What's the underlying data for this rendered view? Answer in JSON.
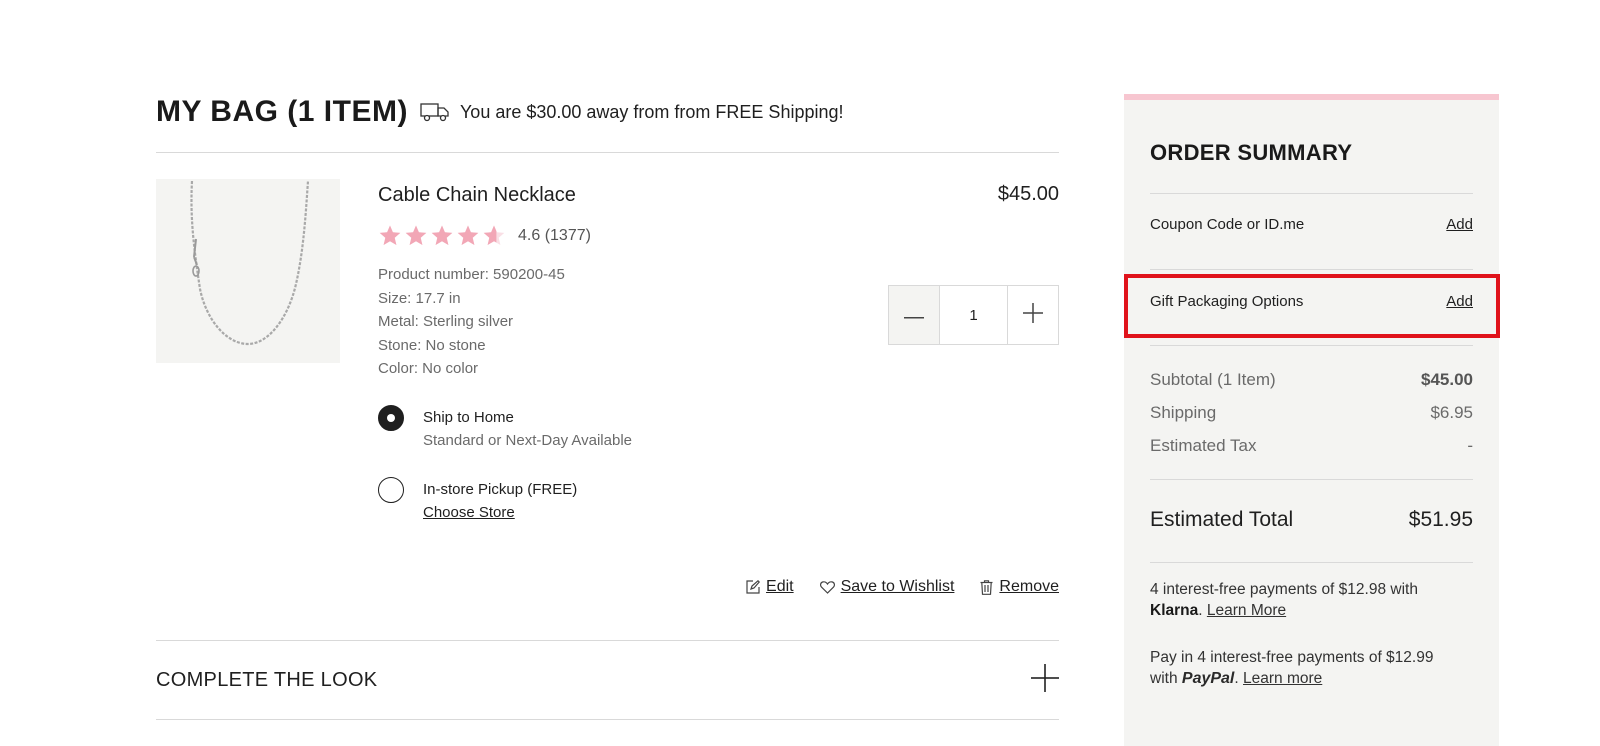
{
  "bag": {
    "title": "MY BAG (1 ITEM)",
    "shipping_message": "You are $30.00 away from from FREE Shipping!"
  },
  "item": {
    "name": "Cable Chain Necklace",
    "price": "$45.00",
    "rating_value": 4.6,
    "rating_text": "4.6 (1377)",
    "attributes": [
      "Product number: 590200-45",
      "Size: 17.7 in",
      "Metal: Sterling silver",
      "Stone: No stone",
      "Color: No color"
    ],
    "quantity": "1",
    "shipping_options": {
      "home_title": "Ship to Home",
      "home_sub": "Standard or Next-Day Available",
      "pickup_title": "In-store Pickup (FREE)",
      "pickup_link": "Choose Store"
    },
    "actions": {
      "edit": "Edit",
      "wishlist": "Save to Wishlist",
      "remove": "Remove"
    }
  },
  "complete_the_look": "COMPLETE THE LOOK",
  "summary": {
    "title": "ORDER SUMMARY",
    "coupon_label": "Coupon Code or ID.me",
    "coupon_action": "Add",
    "gift_label": "Gift Packaging Options",
    "gift_action": "Add",
    "subtotal_label": "Subtotal (1 Item)",
    "subtotal_value": "$45.00",
    "shipping_label": "Shipping",
    "shipping_value": "$6.95",
    "tax_label": "Estimated Tax",
    "tax_value": "-",
    "total_label": "Estimated Total",
    "total_value": "$51.95",
    "klarna_text": "4 interest-free payments of $12.98 with",
    "klarna_brand": "Klarna",
    "klarna_period": ".",
    "klarna_link": "Learn More",
    "paypal_text": "Pay in 4 interest-free payments of $12.99",
    "paypal_with": "with",
    "paypal_brand": "PayPal",
    "paypal_period": ".",
    "paypal_link": "Learn more"
  },
  "colors": {
    "star": "#f2a7b6",
    "summary_bg": "#f4f4f2",
    "summary_accent": "#f7c6d0",
    "highlight": "#e0131b"
  },
  "icons": [
    "truck-icon",
    "star-icon",
    "minus-icon",
    "plus-icon",
    "edit-icon",
    "heart-icon",
    "trash-icon",
    "expand-plus-icon"
  ]
}
